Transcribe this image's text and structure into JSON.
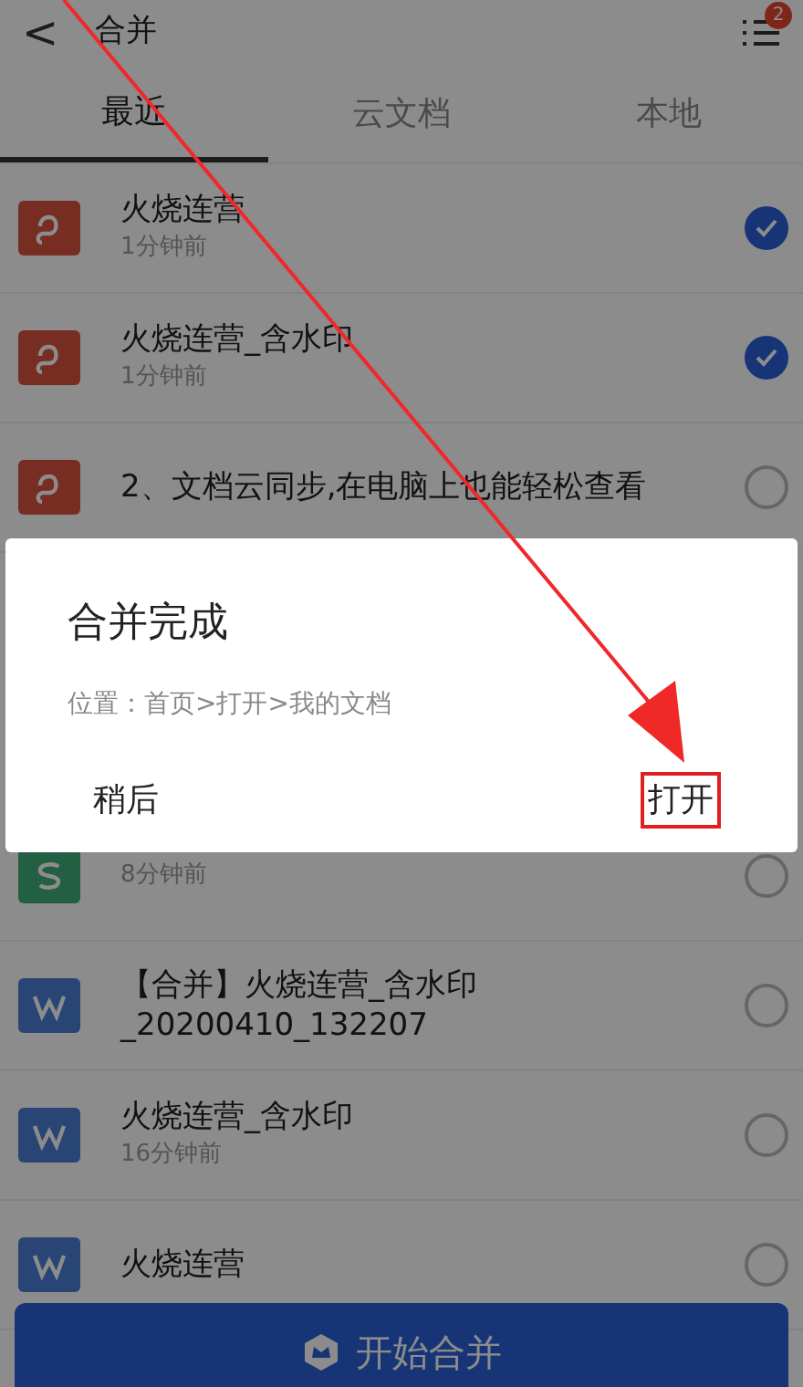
{
  "header": {
    "back": "<",
    "title": "合并",
    "badge": "2"
  },
  "tabs": [
    {
      "label": "最近",
      "selected": true
    },
    {
      "label": "云文档",
      "selected": false
    },
    {
      "label": "本地",
      "selected": false
    }
  ],
  "files": [
    {
      "kind": "p",
      "name": "火烧连营",
      "time": "1分钟前",
      "checked": true
    },
    {
      "kind": "p",
      "name": "火烧连营_含水印",
      "time": "1分钟前",
      "checked": true
    },
    {
      "kind": "p",
      "name": "2、文档云同步,在电脑上也能轻松查看",
      "checked": false
    },
    {
      "kind": "s",
      "time": "8分钟前",
      "checked": false
    },
    {
      "kind": "w",
      "name": "【合并】火烧连营_含水印_20200410_132207",
      "checked": false
    },
    {
      "kind": "w",
      "name": "火烧连营_含水印",
      "time": "16分钟前",
      "checked": false
    },
    {
      "kind": "w",
      "name": "火烧连营",
      "checked": false
    }
  ],
  "merge_button": "开始合并",
  "dialog": {
    "title": "合并完成",
    "message": "位置：首页>打开>我的文档",
    "buttons": [
      {
        "label": "稍后",
        "highlighted": false
      },
      {
        "label": "打开",
        "highlighted": true
      }
    ]
  }
}
